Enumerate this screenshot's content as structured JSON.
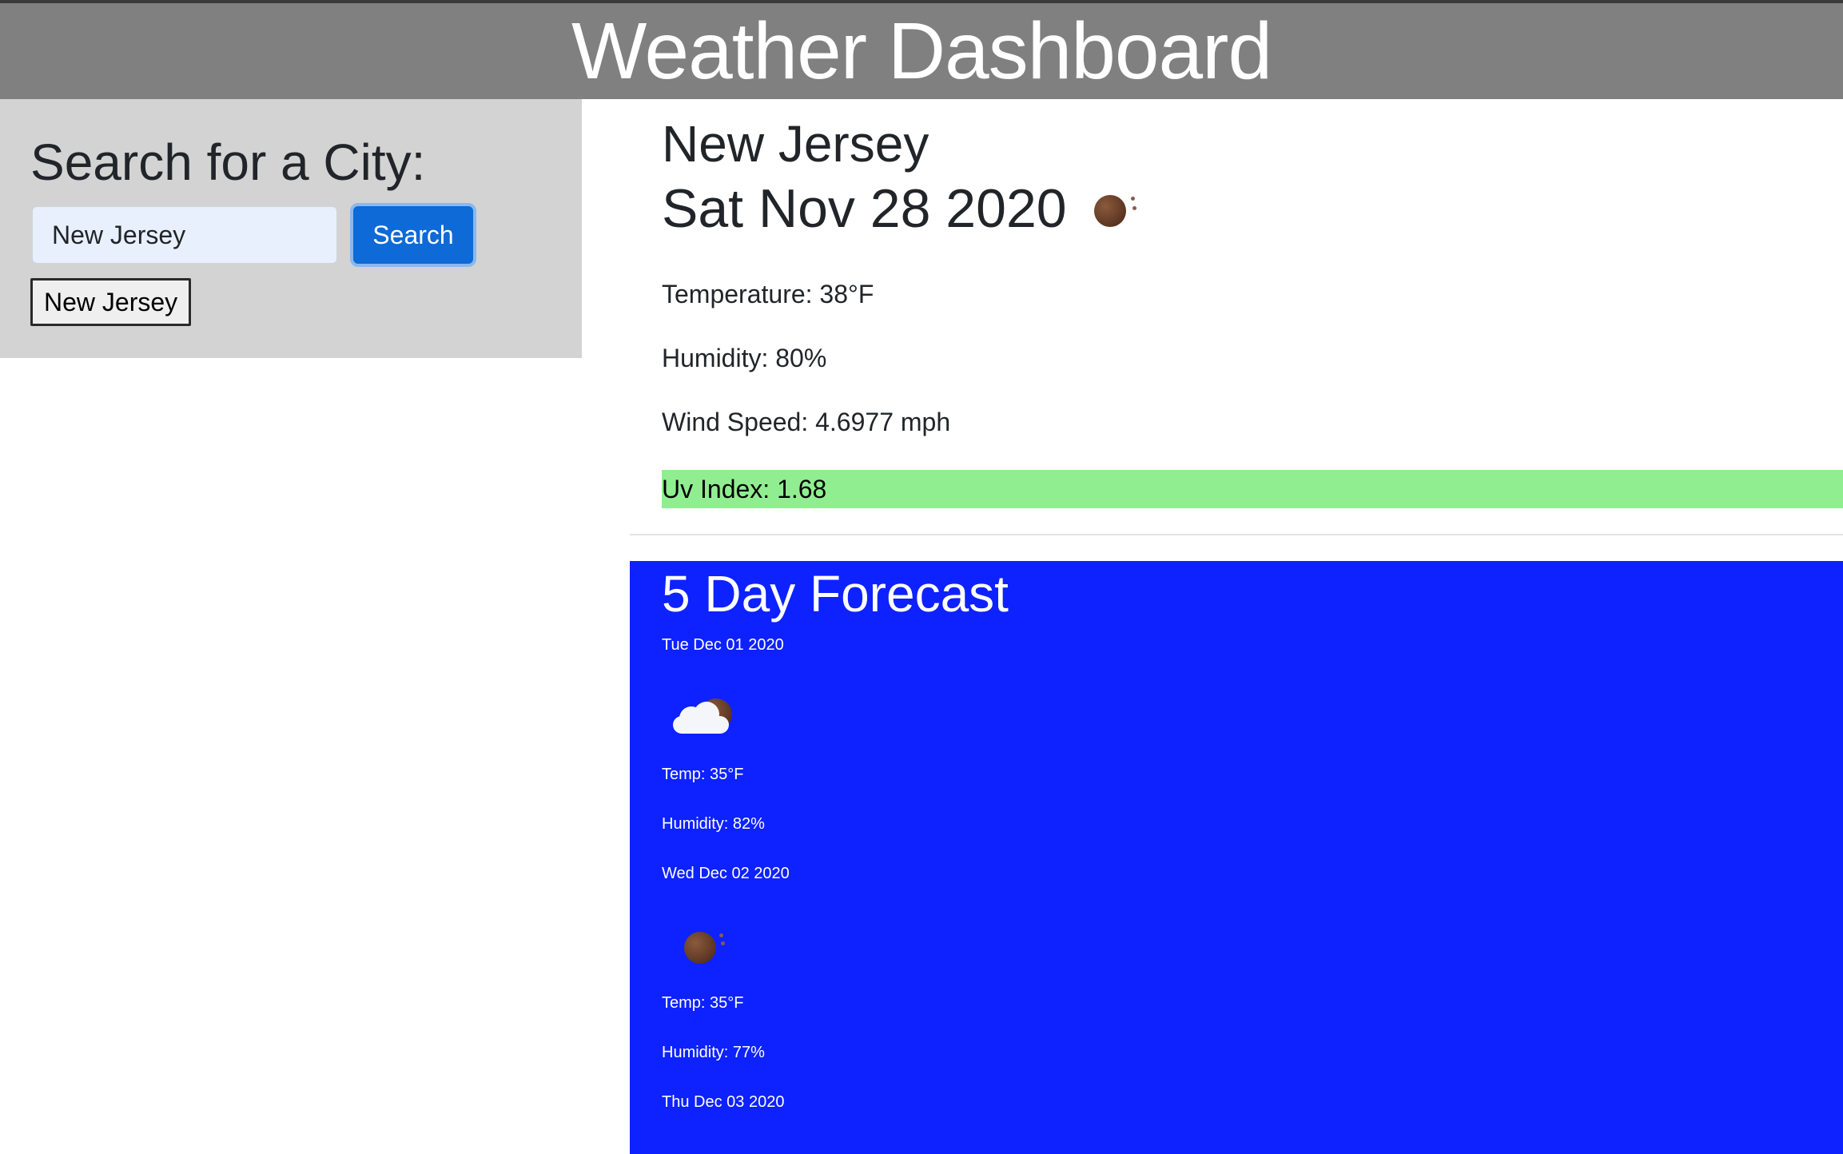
{
  "header": {
    "title": "Weather Dashboard"
  },
  "sidebar": {
    "heading": "Search for a City:",
    "search_value": "New Jersey",
    "search_button": "Search",
    "history": [
      "New Jersey"
    ]
  },
  "current": {
    "city": "New Jersey",
    "date": "Sat Nov 28 2020",
    "icon": "moon-night-icon",
    "temperature": "Temperature: 38°F",
    "humidity": "Humidity: 80%",
    "wind": "Wind Speed: 4.6977 mph",
    "uv": "Uv Index: 1.68",
    "uv_color": "#90ee90"
  },
  "forecast": {
    "heading": "5 Day Forecast",
    "bg_color": "#0d22ff",
    "days": [
      {
        "date": "Tue Dec 01 2020",
        "icon": "cloud-moon-icon",
        "temp": "Temp: 35°F",
        "humidity": "Humidity: 82%"
      },
      {
        "date": "Wed Dec 02 2020",
        "icon": "moon-night-icon",
        "temp": "Temp: 35°F",
        "humidity": "Humidity: 77%"
      },
      {
        "date": "Thu Dec 03 2020"
      }
    ]
  }
}
